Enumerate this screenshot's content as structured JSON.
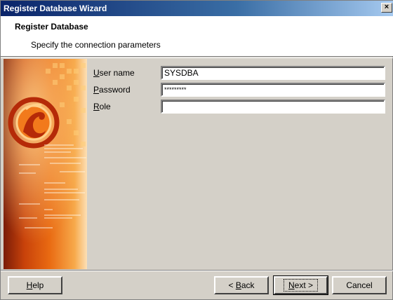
{
  "window": {
    "title": "Register Database Wizard",
    "close_glyph": "×"
  },
  "header": {
    "title": "Register Database",
    "subtitle": "Specify the connection parameters"
  },
  "form": {
    "user_name": {
      "label_first": "U",
      "label_rest": "ser name",
      "value": "SYSDBA"
    },
    "password": {
      "label_first": "P",
      "label_rest": "assword",
      "value": "*********"
    },
    "role": {
      "label_first": "R",
      "label_rest": "ole",
      "value": ""
    }
  },
  "buttons": {
    "help": {
      "first": "H",
      "rest": "elp"
    },
    "back": {
      "prefix": "< ",
      "first": "B",
      "rest": "ack"
    },
    "next": {
      "first": "N",
      "rest": "ext >"
    },
    "cancel": {
      "label": "Cancel"
    }
  },
  "colors": {
    "title_gradient_start": "#0a246a",
    "title_gradient_end": "#a6caf0",
    "dialog_bg": "#d4d0c8"
  },
  "icons": {
    "side_logo": "firebird-logo-icon"
  }
}
